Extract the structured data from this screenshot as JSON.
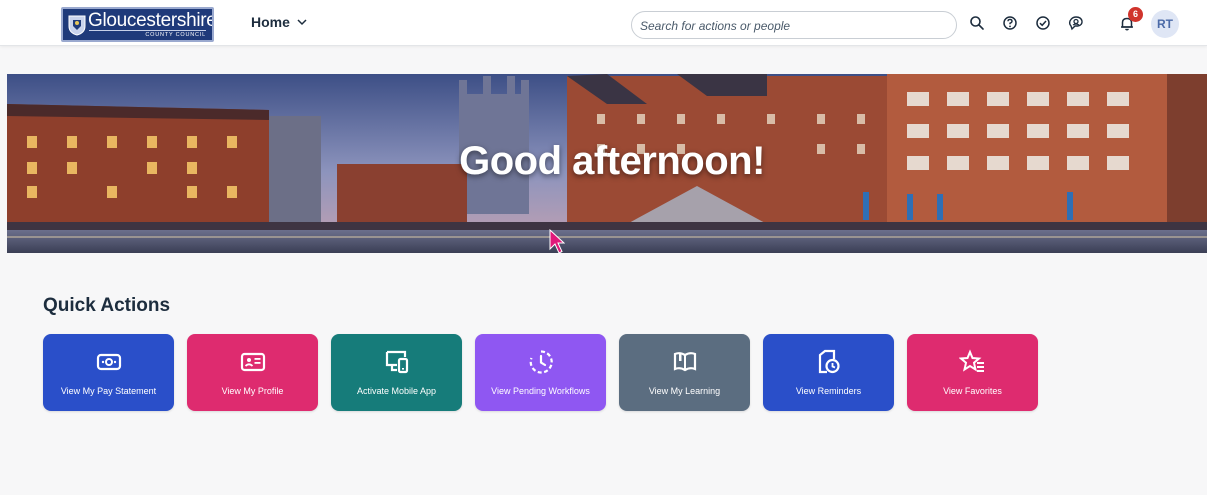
{
  "header": {
    "logo": {
      "name": "Gloucestershire",
      "subtitle": "COUNTY COUNCIL"
    },
    "home_label": "Home",
    "search": {
      "placeholder": "Search for actions or people"
    },
    "icons": [
      "search-icon",
      "help-icon",
      "tasks-check-icon",
      "chat-bot-icon",
      "bell-icon"
    ],
    "notification_count": "6",
    "avatar_initials": "RT"
  },
  "banner": {
    "greeting": "Good afternoon!"
  },
  "quick_actions": {
    "title": "Quick Actions",
    "tiles": [
      {
        "label": "View My Pay Statement",
        "icon": "pay-statement-icon",
        "color": "#2a4fc9"
      },
      {
        "label": "View My Profile",
        "icon": "profile-card-icon",
        "color": "#de2b6f"
      },
      {
        "label": "Activate Mobile App",
        "icon": "mobile-device-icon",
        "color": "#167c7a"
      },
      {
        "label": "View Pending Workflows",
        "icon": "pending-clock-icon",
        "color": "#8f57f2"
      },
      {
        "label": "View My Learning",
        "icon": "learning-book-icon",
        "color": "#5b6d80"
      },
      {
        "label": "View Reminders",
        "icon": "reminder-icon",
        "color": "#2a4fc9"
      },
      {
        "label": "View Favorites",
        "icon": "favorites-star-icon",
        "color": "#de2b6f"
      }
    ]
  }
}
